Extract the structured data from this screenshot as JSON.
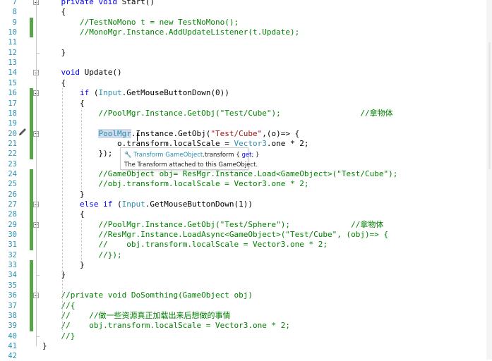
{
  "lines": [
    {
      "num": "7",
      "tokens": [
        {
          "t": "    "
        },
        {
          "t": "private void ",
          "c": "kw"
        },
        {
          "t": "Start()"
        }
      ]
    },
    {
      "num": "8",
      "tokens": [
        {
          "t": "    {"
        }
      ]
    },
    {
      "num": "9",
      "tokens": [
        {
          "t": "        "
        },
        {
          "t": "//TestNoMono t = new TestNoMono();",
          "c": "cm"
        }
      ]
    },
    {
      "num": "10",
      "tokens": [
        {
          "t": "        "
        },
        {
          "t": "//MonoMgr.Instance.AddUpdateListener(t.Update);",
          "c": "cm"
        }
      ]
    },
    {
      "num": "11",
      "tokens": []
    },
    {
      "num": "12",
      "tokens": [
        {
          "t": "    }"
        }
      ]
    },
    {
      "num": "13",
      "tokens": []
    },
    {
      "num": "14",
      "tokens": [
        {
          "t": "    "
        },
        {
          "t": "void ",
          "c": "kw"
        },
        {
          "t": "Update()"
        }
      ]
    },
    {
      "num": "15",
      "tokens": [
        {
          "t": "    {"
        }
      ]
    },
    {
      "num": "16",
      "tokens": [
        {
          "t": "        "
        },
        {
          "t": "if ",
          "c": "kw"
        },
        {
          "t": "("
        },
        {
          "t": "Input",
          "c": "ty"
        },
        {
          "t": ".GetMouseButtonDown(0))"
        }
      ]
    },
    {
      "num": "17",
      "tokens": [
        {
          "t": "        {"
        }
      ]
    },
    {
      "num": "18",
      "tokens": [
        {
          "t": "            "
        },
        {
          "t": "//PoolMgr.Instance.GetObj(\"Test/Cube\");                 //拿物体",
          "c": "cm"
        }
      ]
    },
    {
      "num": "19",
      "tokens": []
    },
    {
      "num": "20",
      "tokens": [
        {
          "t": "            "
        },
        {
          "t": "PoolMgr",
          "c": "ty hl"
        },
        {
          "t": ".Instance.GetObj("
        },
        {
          "t": "\"Test/Cube\"",
          "c": "st"
        },
        {
          "t": ",(o)=> {"
        }
      ]
    },
    {
      "num": "21",
      "tokens": [
        {
          "t": "                o.transform.localScale = "
        },
        {
          "t": "Vector3",
          "c": "ty"
        },
        {
          "t": ".one * 2;"
        }
      ]
    },
    {
      "num": "22",
      "tokens": [
        {
          "t": "            });"
        }
      ]
    },
    {
      "num": "23",
      "tokens": []
    },
    {
      "num": "24",
      "tokens": [
        {
          "t": "            "
        },
        {
          "t": "//GameObject obj= ResMgr.Instance.Load<GameObject>(\"Test/Cube\");",
          "c": "cm"
        }
      ]
    },
    {
      "num": "25",
      "tokens": [
        {
          "t": "            "
        },
        {
          "t": "//obj.transform.localScale = Vector3.one * 2;",
          "c": "cm"
        }
      ]
    },
    {
      "num": "26",
      "tokens": [
        {
          "t": "        }"
        }
      ]
    },
    {
      "num": "27",
      "tokens": [
        {
          "t": "        "
        },
        {
          "t": "else if ",
          "c": "kw"
        },
        {
          "t": "("
        },
        {
          "t": "Input",
          "c": "ty"
        },
        {
          "t": ".GetMouseButtonDown(1))"
        }
      ]
    },
    {
      "num": "28",
      "tokens": [
        {
          "t": "        {"
        }
      ]
    },
    {
      "num": "29",
      "tokens": [
        {
          "t": "            "
        },
        {
          "t": "//PoolMgr.Instance.GetObj(\"Test/Sphere\");             //拿物体",
          "c": "cm"
        }
      ]
    },
    {
      "num": "30",
      "tokens": [
        {
          "t": "            "
        },
        {
          "t": "//ResMgr.Instance.LoadAsync<GameObject>(\"Test/Cube\", (obj)=> {",
          "c": "cm"
        }
      ]
    },
    {
      "num": "31",
      "tokens": [
        {
          "t": "            "
        },
        {
          "t": "//    obj.transform.localScale = Vector3.one * 2;",
          "c": "cm"
        }
      ]
    },
    {
      "num": "32",
      "tokens": [
        {
          "t": "            "
        },
        {
          "t": "//});",
          "c": "cm"
        }
      ]
    },
    {
      "num": "33",
      "tokens": [
        {
          "t": "        }"
        }
      ]
    },
    {
      "num": "34",
      "tokens": [
        {
          "t": "    }"
        }
      ]
    },
    {
      "num": "35",
      "tokens": []
    },
    {
      "num": "36",
      "tokens": [
        {
          "t": "    "
        },
        {
          "t": "//private void DoSomthing(GameObject obj)",
          "c": "cm"
        }
      ]
    },
    {
      "num": "37",
      "tokens": [
        {
          "t": "    "
        },
        {
          "t": "//{",
          "c": "cm"
        }
      ]
    },
    {
      "num": "38",
      "tokens": [
        {
          "t": "    "
        },
        {
          "t": "//    //做一些资源真正加载出来后想做的事情",
          "c": "cm"
        }
      ]
    },
    {
      "num": "39",
      "tokens": [
        {
          "t": "    "
        },
        {
          "t": "//    obj.transform.localScale = Vector3.one * 2;",
          "c": "cm"
        }
      ]
    },
    {
      "num": "40",
      "tokens": [
        {
          "t": "    "
        },
        {
          "t": "//}",
          "c": "cm"
        }
      ]
    },
    {
      "num": "41",
      "tokens": [
        {
          "t": "}"
        }
      ]
    },
    {
      "num": "42",
      "tokens": []
    }
  ],
  "tooltip": {
    "icon": "wrench-icon",
    "type_name": "Transform",
    "owner": "GameObject",
    "member": ".transform",
    "accessor_open": " { ",
    "accessor_kw": "get",
    "accessor_close": "; }",
    "description": "The Transform attached to this GameObject."
  },
  "colors": {
    "keyword": "#0000ff",
    "type": "#2b91af",
    "comment": "#008000",
    "string": "#a31515",
    "line_number": "#2b91af",
    "change_bar": "#57a64a",
    "selection": "#cfd9ea"
  }
}
